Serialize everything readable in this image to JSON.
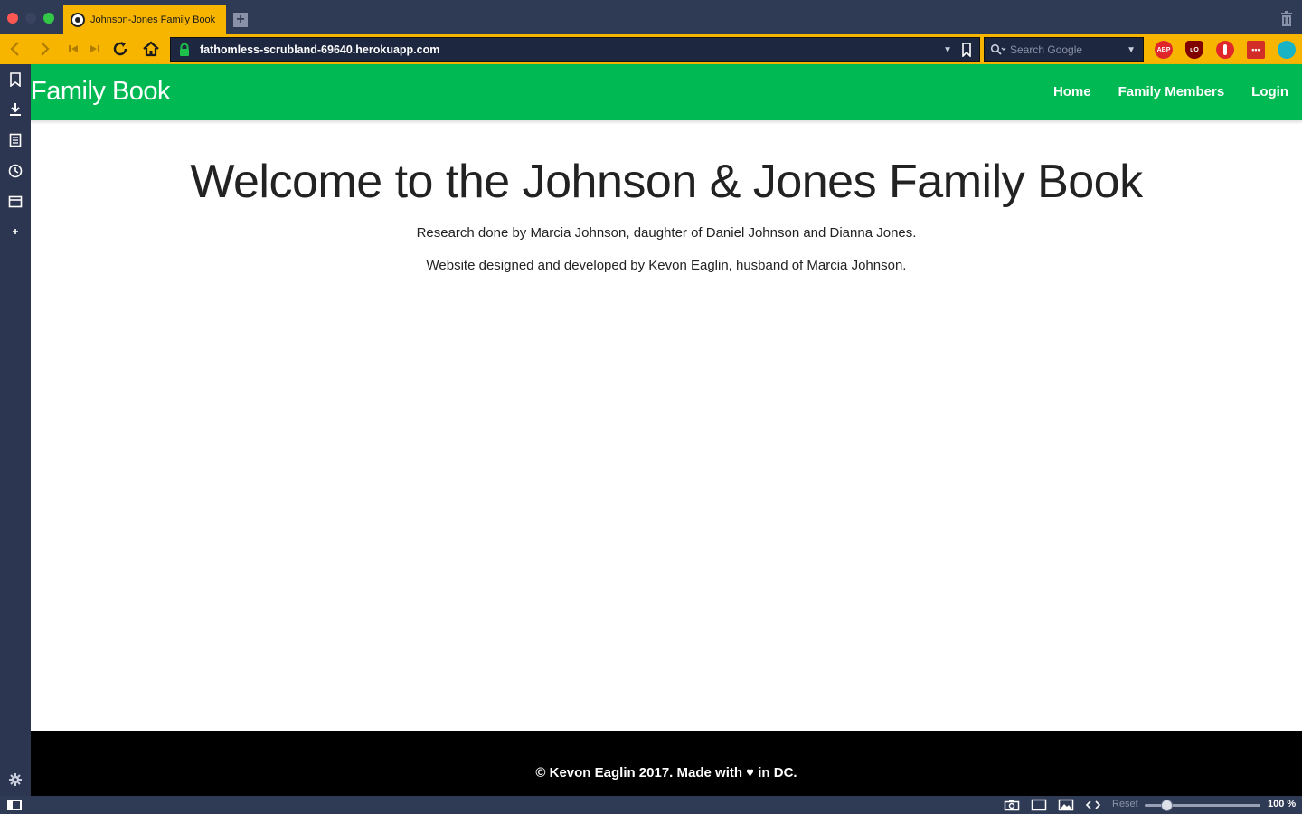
{
  "browser": {
    "tab_title": "Johnson-Jones Family Book",
    "new_tab_label": "+",
    "url": "fathomless-scrubland-69640.herokuapp.com",
    "search_placeholder": "Search Google",
    "extensions": [
      {
        "name": "adblock-plus-icon",
        "label": "ABP",
        "color": "#e0262b"
      },
      {
        "name": "ublock-icon",
        "label": "uO",
        "color": "#800000"
      },
      {
        "name": "privacy-badger-icon",
        "label": "",
        "color": "#e0262b"
      },
      {
        "name": "lastpass-icon",
        "label": "•••",
        "color": "#d32d27"
      },
      {
        "name": "extension-icon",
        "label": "",
        "color": "#18b3c4"
      }
    ],
    "accent_color": "#f7b500",
    "chrome_color": "#2f3a55"
  },
  "site": {
    "brand": "Family Book",
    "nav": {
      "home": "Home",
      "family_members": "Family Members",
      "login": "Login"
    },
    "hero": {
      "heading": "Welcome to the Johnson & Jones Family Book",
      "line1": "Research done by Marcia Johnson, daughter of Daniel Johnson and Dianna Jones.",
      "line2": "Website designed and developed by Kevon Eaglin, husband of Marcia Johnson."
    },
    "footer": "© Kevon Eaglin 2017. Made with ♥ in DC.",
    "nav_color": "#00b952"
  },
  "statusbar": {
    "reset_label": "Reset",
    "zoom_level": "100 %",
    "zoom_fraction": 0.2
  }
}
